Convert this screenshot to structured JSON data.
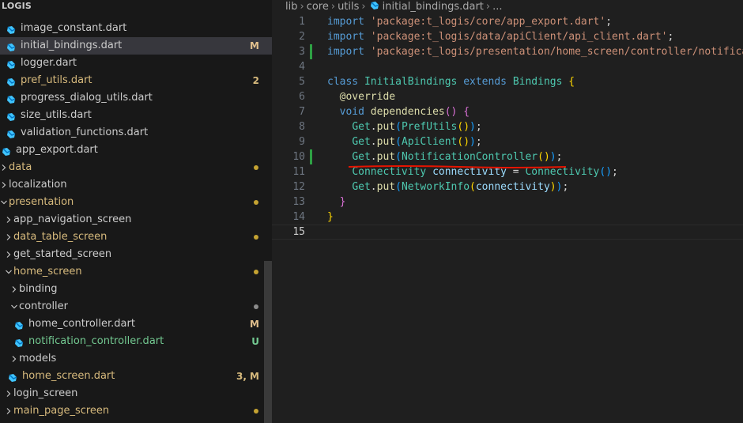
{
  "explorer": {
    "section_title": "LOGIS",
    "items": [
      {
        "label": "image_constant.dart",
        "type": "file",
        "indent": 1,
        "color": "default"
      },
      {
        "label": "initial_bindings.dart",
        "type": "file",
        "indent": 1,
        "color": "default",
        "badge": "M",
        "badge_color": "mod",
        "selected": true
      },
      {
        "label": "logger.dart",
        "type": "file",
        "indent": 1,
        "color": "default"
      },
      {
        "label": "pref_utils.dart",
        "type": "file",
        "indent": 1,
        "color": "yellow",
        "badge": "2",
        "badge_color": "yellow"
      },
      {
        "label": "progress_dialog_utils.dart",
        "type": "file",
        "indent": 1,
        "color": "default"
      },
      {
        "label": "size_utils.dart",
        "type": "file",
        "indent": 1,
        "color": "default"
      },
      {
        "label": "validation_functions.dart",
        "type": "file",
        "indent": 1,
        "color": "default"
      },
      {
        "label": "app_export.dart",
        "type": "file",
        "indent": 0,
        "color": "default"
      },
      {
        "label": "data",
        "type": "folder",
        "indent": 0,
        "color": "yellow",
        "dot": "yellow"
      },
      {
        "label": "localization",
        "type": "folder",
        "indent": 0,
        "color": "default"
      },
      {
        "label": "presentation",
        "type": "folder-open",
        "indent": 0,
        "color": "yellow",
        "dot": "yellow"
      },
      {
        "label": "app_navigation_screen",
        "type": "folder",
        "indent": 1,
        "color": "default"
      },
      {
        "label": "data_table_screen",
        "type": "folder",
        "indent": 1,
        "color": "yellow",
        "dot": "yellow"
      },
      {
        "label": "get_started_screen",
        "type": "folder",
        "indent": 1,
        "color": "default"
      },
      {
        "label": "home_screen",
        "type": "folder-open",
        "indent": 1,
        "color": "yellow",
        "dot": "yellow"
      },
      {
        "label": "binding",
        "type": "folder",
        "indent": 2,
        "color": "default"
      },
      {
        "label": "controller",
        "type": "folder-open",
        "indent": 2,
        "color": "default",
        "dot": "gray"
      },
      {
        "label": "home_controller.dart",
        "type": "file",
        "indent": 3,
        "color": "default",
        "badge": "M",
        "badge_color": "mod"
      },
      {
        "label": "notification_controller.dart",
        "type": "file",
        "indent": 3,
        "color": "green",
        "badge": "U",
        "badge_color": "green"
      },
      {
        "label": "models",
        "type": "folder",
        "indent": 2,
        "color": "default"
      },
      {
        "label": "home_screen.dart",
        "type": "file",
        "indent": 2,
        "color": "yellow",
        "badge": "3, M",
        "badge_color": "yellow"
      },
      {
        "label": "login_screen",
        "type": "folder",
        "indent": 1,
        "color": "default"
      },
      {
        "label": "main_page_screen",
        "type": "folder",
        "indent": 1,
        "color": "yellow",
        "dot": "yellow"
      }
    ]
  },
  "breadcrumb": {
    "parts": [
      "lib",
      "core",
      "utils"
    ],
    "file": "initial_bindings.dart",
    "tail": "..."
  },
  "code": {
    "current_line": 15,
    "lines": [
      {
        "n": "1",
        "tokens": [
          [
            "kw",
            "import"
          ],
          [
            "plain",
            " "
          ],
          [
            "str",
            "'package:t_logis/core/app_export.dart'"
          ],
          [
            "plain",
            ";"
          ]
        ]
      },
      {
        "n": "2",
        "tokens": [
          [
            "kw",
            "import"
          ],
          [
            "plain",
            " "
          ],
          [
            "str",
            "'package:t_logis/data/apiClient/api_client.dart'"
          ],
          [
            "plain",
            ";"
          ]
        ]
      },
      {
        "n": "3",
        "gutter": true,
        "tokens": [
          [
            "kw",
            "import"
          ],
          [
            "plain",
            " "
          ],
          [
            "str",
            "'package:t_logis/presentation/home_screen/controller/notificat"
          ]
        ]
      },
      {
        "n": "4",
        "tokens": []
      },
      {
        "n": "5",
        "tokens": [
          [
            "kw",
            "class"
          ],
          [
            "plain",
            " "
          ],
          [
            "cls",
            "InitialBindings"
          ],
          [
            "plain",
            " "
          ],
          [
            "kw",
            "extends"
          ],
          [
            "plain",
            " "
          ],
          [
            "cls",
            "Bindings"
          ],
          [
            "plain",
            " "
          ],
          [
            "b1",
            "{"
          ]
        ]
      },
      {
        "n": "6",
        "tokens": [
          [
            "plain",
            "  "
          ],
          [
            "ann",
            "@override"
          ]
        ]
      },
      {
        "n": "7",
        "tokens": [
          [
            "plain",
            "  "
          ],
          [
            "kw",
            "void"
          ],
          [
            "plain",
            " "
          ],
          [
            "fn",
            "dependencies"
          ],
          [
            "b2",
            "()"
          ],
          [
            "plain",
            " "
          ],
          [
            "b2",
            "{"
          ]
        ]
      },
      {
        "n": "8",
        "tokens": [
          [
            "plain",
            "    "
          ],
          [
            "cls",
            "Get"
          ],
          [
            "plain",
            "."
          ],
          [
            "fn",
            "put"
          ],
          [
            "b3",
            "("
          ],
          [
            "cls",
            "PrefUtils"
          ],
          [
            "b1",
            "()"
          ],
          [
            "b3",
            ")"
          ],
          [
            "plain",
            ";"
          ]
        ]
      },
      {
        "n": "9",
        "tokens": [
          [
            "plain",
            "    "
          ],
          [
            "cls",
            "Get"
          ],
          [
            "plain",
            "."
          ],
          [
            "fn",
            "put"
          ],
          [
            "b3",
            "("
          ],
          [
            "cls",
            "ApiClient"
          ],
          [
            "b1",
            "()"
          ],
          [
            "b3",
            ")"
          ],
          [
            "plain",
            ";"
          ]
        ]
      },
      {
        "n": "10",
        "gutter": true,
        "tokens": [
          [
            "plain",
            "    "
          ],
          [
            "cls",
            "Get"
          ],
          [
            "plain",
            "."
          ],
          [
            "fn",
            "put"
          ],
          [
            "b3",
            "("
          ],
          [
            "cls",
            "NotificationController"
          ],
          [
            "b1",
            "()"
          ],
          [
            "b3",
            ")"
          ],
          [
            "plain",
            ";"
          ]
        ]
      },
      {
        "n": "11",
        "tokens": [
          [
            "plain",
            "    "
          ],
          [
            "cls",
            "Connectivity"
          ],
          [
            "plain",
            " "
          ],
          [
            "var",
            "connectivity"
          ],
          [
            "plain",
            " = "
          ],
          [
            "cls",
            "Connectivity"
          ],
          [
            "b3",
            "()"
          ],
          [
            "plain",
            ";"
          ]
        ]
      },
      {
        "n": "12",
        "tokens": [
          [
            "plain",
            "    "
          ],
          [
            "cls",
            "Get"
          ],
          [
            "plain",
            "."
          ],
          [
            "fn",
            "put"
          ],
          [
            "b3",
            "("
          ],
          [
            "cls",
            "NetworkInfo"
          ],
          [
            "b1",
            "("
          ],
          [
            "var",
            "connectivity"
          ],
          [
            "b1",
            ")"
          ],
          [
            "b3",
            ")"
          ],
          [
            "plain",
            ";"
          ]
        ]
      },
      {
        "n": "13",
        "tokens": [
          [
            "plain",
            "  "
          ],
          [
            "b2",
            "}"
          ]
        ]
      },
      {
        "n": "14",
        "tokens": [
          [
            "b1",
            "}"
          ]
        ]
      },
      {
        "n": "15",
        "tokens": []
      }
    ]
  },
  "colors": {
    "accent_underline": "#e51400",
    "git_added": "#2ea043",
    "modified": "#e2c08d",
    "untracked": "#73c991",
    "folder_dot": "#c5a332"
  }
}
